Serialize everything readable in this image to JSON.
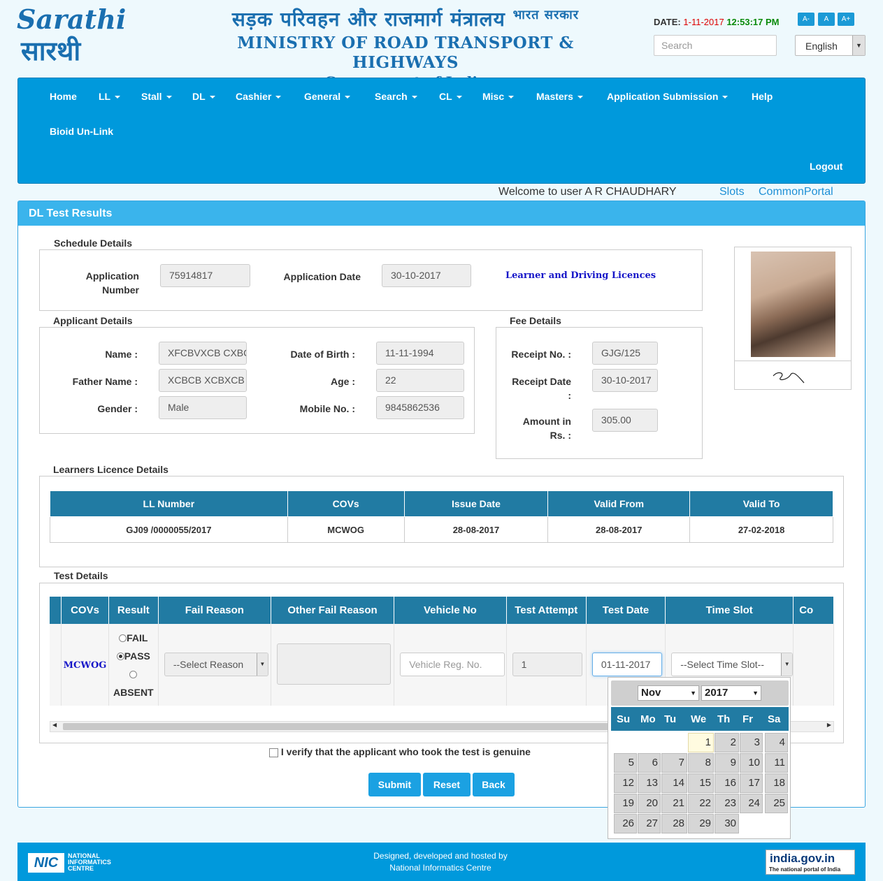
{
  "header": {
    "logo_text": "Sarathi",
    "logo_hindi": "सारथी",
    "hindi_title": "सड़क परिवहन और राजमार्ग मंत्रालय",
    "hindi_govt": "भारत सरकार",
    "title": "MINISTRY OF ROAD TRANSPORT & HIGHWAYS",
    "subtitle": "Government of India",
    "date_label": "DATE:",
    "date_value": "1-11-2017",
    "time_value": "12:53:17 PM",
    "font_buttons": [
      "A-",
      "A",
      "A+"
    ],
    "search_placeholder": "Search",
    "language": "English"
  },
  "nav": {
    "items": [
      "Home",
      "LL",
      "Stall",
      "DL",
      "Cashier",
      "General",
      "Search",
      "CL",
      "Misc",
      "Masters",
      "Application Submission",
      "Help"
    ],
    "bioid": "Bioid Un-Link",
    "logout": "Logout"
  },
  "welcome": {
    "text": "Welcome to user A R CHAUDHARY",
    "slots": "Slots",
    "common_portal": "CommonPortal"
  },
  "panel_title": "DL Test Results",
  "schedule": {
    "legend": "Schedule Details",
    "app_no_label_1": "Application",
    "app_no_label_2": "Number",
    "app_no": "75914817",
    "app_date_label": "Application Date",
    "app_date": "30-10-2017",
    "licence_type": "Learner and Driving Licences"
  },
  "applicant": {
    "legend": "Applicant Details",
    "name_label": "Name :",
    "name": "XFCBVXCB CXBCX",
    "father_label": "Father Name :",
    "father": "XCBCB XCBXCB",
    "gender_label": "Gender :",
    "gender": "Male",
    "dob_label": "Date of Birth :",
    "dob": "11-11-1994",
    "age_label": "Age :",
    "age": "22",
    "mobile_label": "Mobile No. :",
    "mobile": "9845862536"
  },
  "fee": {
    "legend": "Fee Details",
    "receipt_no_label": "Receipt No. :",
    "receipt_no": "GJG/125",
    "receipt_date_label_1": "Receipt Date",
    "receipt_date_label_2": ":",
    "receipt_date": "30-10-2017",
    "amount_label_1": "Amount in",
    "amount_label_2": "Rs. :",
    "amount": "305.00"
  },
  "learners": {
    "legend": "Learners Licence Details",
    "headers": [
      "LL Number",
      "COVs",
      "Issue Date",
      "Valid From",
      "Valid To"
    ],
    "row": [
      "GJ09 /0000055/2017",
      "MCWOG",
      "28-08-2017",
      "28-08-2017",
      "27-02-2018"
    ]
  },
  "test": {
    "legend": "Test Details",
    "headers": [
      "COVs",
      "Result",
      "Fail Reason",
      "Other Fail Reason",
      "Vehicle No",
      "Test Attempt",
      "Test Date",
      "Time Slot",
      "Co"
    ],
    "cov": "MCWOG",
    "result_options": [
      "FAIL",
      "PASS",
      "ABSENT"
    ],
    "selected_result": "PASS",
    "fail_reason": "--Select Reason",
    "vehicle_placeholder": "Vehicle Reg. No.",
    "attempt": "1",
    "test_date": "01-11-2017",
    "time_slot": "--Select Time Slot--"
  },
  "verify_text": "I verify that the applicant who took the test is genuine",
  "buttons": {
    "submit": "Submit",
    "reset": "Reset",
    "back": "Back"
  },
  "footer": {
    "nic_abbr": "NIC",
    "nic_name": [
      "NATIONAL",
      "INFORMATICS",
      "CENTRE"
    ],
    "line1": "Designed, developed and hosted by",
    "line2": "National Informatics Centre",
    "portal": "india.gov.in",
    "portal_tag": "The national portal of India"
  },
  "calendar": {
    "month": "Nov",
    "year": "2017",
    "weekdays": [
      "Su",
      "Mo",
      "Tu",
      "We",
      "Th",
      "Fr",
      "Sa"
    ],
    "first_weekday": 3,
    "days_in_month": 30,
    "today": 1
  },
  "colors": {
    "nav_bg": "#0099dc",
    "table_head": "#217ba3",
    "accent": "#1ba1e2"
  }
}
